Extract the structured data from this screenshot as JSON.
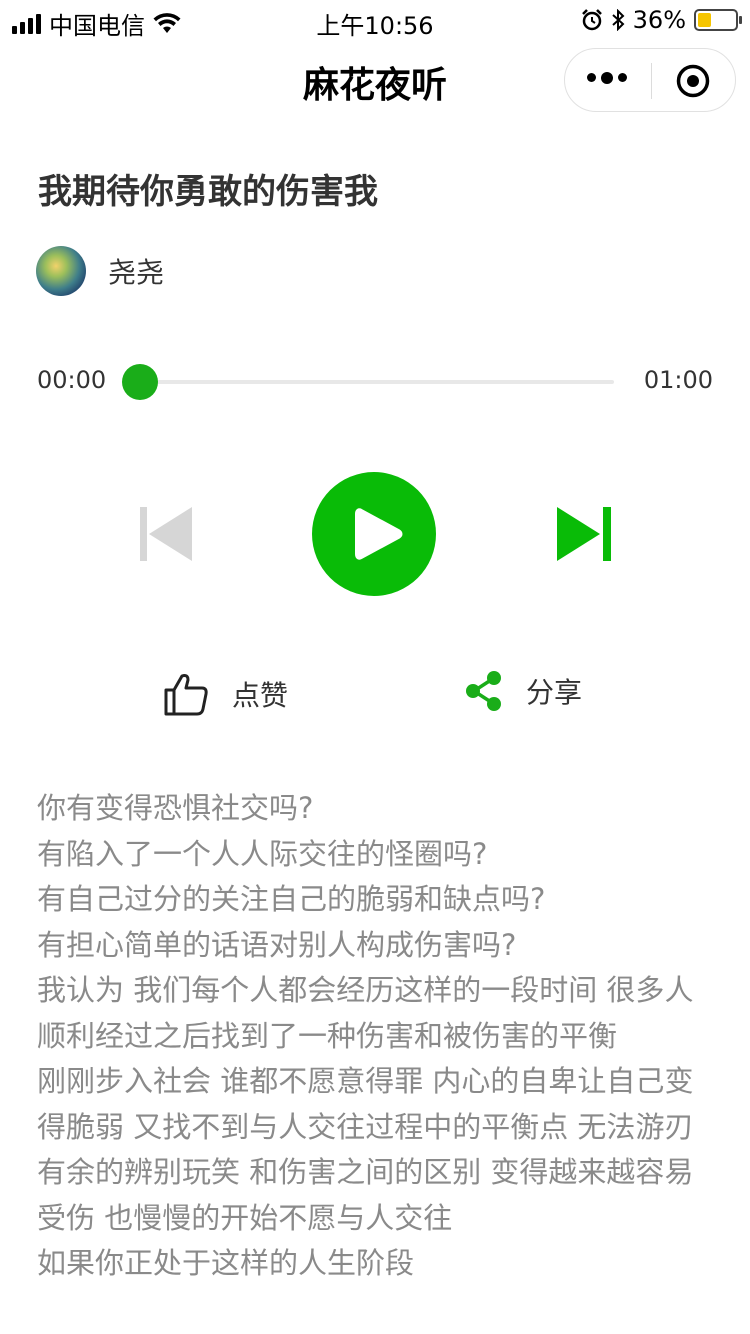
{
  "status_bar": {
    "carrier": "中国电信",
    "time": "上午10:56",
    "battery_percent": "36%",
    "battery_level": 0.36
  },
  "nav": {
    "title": "麻花夜听"
  },
  "article": {
    "title": "我期待你勇敢的伤害我",
    "author": "尧尧"
  },
  "player": {
    "current_time": "00:00",
    "total_time": "01:00",
    "progress": 0.0,
    "accent_color": "#09bb07",
    "disabled_color": "#d6d6d6"
  },
  "actions": {
    "like_label": "点赞",
    "share_label": "分享"
  },
  "content": {
    "lines": [
      "你有变得恐惧社交吗?",
      "有陷入了一个人人际交往的怪圈吗?",
      "有自己过分的关注自己的脆弱和缺点吗?",
      "有担心简单的话语对别人构成伤害吗?",
      "我认为 我们每个人都会经历这样的一段时间 很多人顺利经过之后找到了一种伤害和被伤害的平衡",
      "刚刚步入社会 谁都不愿意得罪 内心的自卑让自己变得脆弱 又找不到与人交往过程中的平衡点 无法游刃有余的辨别玩笑 和伤害之间的区别 变得越来越容易受伤 也慢慢的开始不愿与人交往",
      "如果你正处于这样的人生阶段"
    ]
  }
}
